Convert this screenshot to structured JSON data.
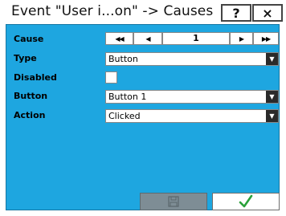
{
  "window": {
    "title": "Event \"User i...on\" -> Causes",
    "help_label": "?",
    "close_label": "×"
  },
  "fields": {
    "cause_label": "Cause",
    "type_label": "Type",
    "disabled_label": "Disabled",
    "button_label": "Button",
    "action_label": "Action"
  },
  "cause_nav": {
    "first_label": "◀◀",
    "prev_label": "◀",
    "counter": "1",
    "next_label": "▶",
    "last_label": "▶▶"
  },
  "type_select": {
    "value": "Button"
  },
  "disabled_checkbox": {
    "checked": false
  },
  "button_select": {
    "value": "Button 1"
  },
  "action_select": {
    "value": "Clicked"
  },
  "footer": {
    "ok_icon": "checkmark-icon",
    "disabled_icon": "save-icon"
  },
  "colors": {
    "panel_bg": "#1ea6e0",
    "ok_check": "#2aa13a",
    "disabled_button": "#7e8d95"
  }
}
